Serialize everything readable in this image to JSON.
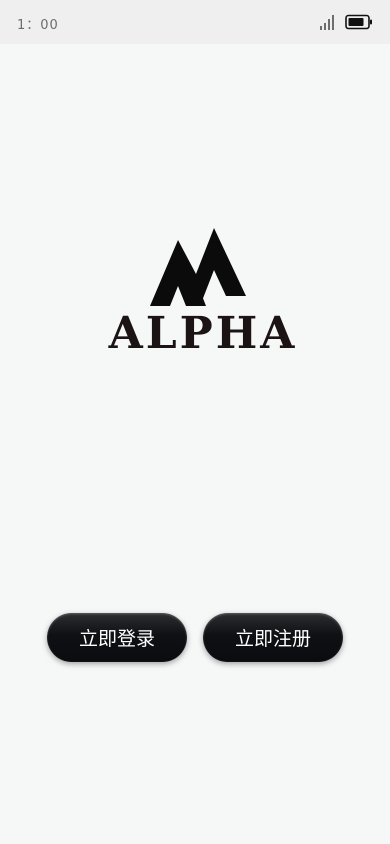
{
  "status_bar": {
    "time": "1：00",
    "signal_icon": "cellular-signal-icon",
    "battery_icon": "battery-icon"
  },
  "logo": {
    "brand_text": "ALPHA",
    "mark_icon": "alpha-mountain-mark-icon"
  },
  "actions": {
    "login_label": "立即登录",
    "register_label": "立即注册"
  },
  "colors": {
    "background": "#f6f7f7",
    "status_bar": "#efefef",
    "button": "#0f1013",
    "logo_text": "#1c1414"
  }
}
